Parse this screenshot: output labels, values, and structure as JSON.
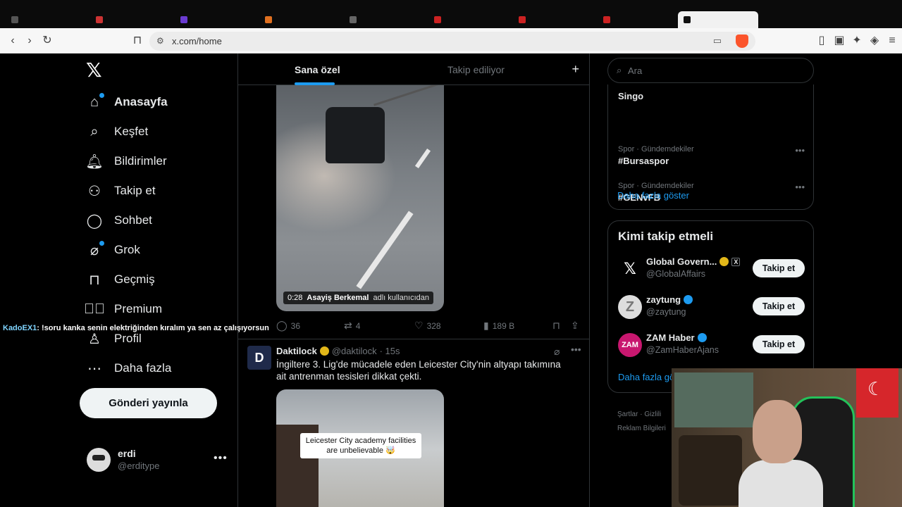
{
  "browser": {
    "url": "x.com/home",
    "shield_badge": "1"
  },
  "nav": {
    "items": [
      {
        "label": "Anasayfa",
        "icon": "home-icon"
      },
      {
        "label": "Keşfet",
        "icon": "search-icon"
      },
      {
        "label": "Bildirimler",
        "icon": "bell-icon"
      },
      {
        "label": "Takip et",
        "icon": "follow-icon"
      },
      {
        "label": "Sohbet",
        "icon": "chat-icon"
      },
      {
        "label": "Grok",
        "icon": "grok-icon"
      },
      {
        "label": "Geçmiş",
        "icon": "bookmark-icon"
      },
      {
        "label": "Premium",
        "icon": "premium-icon"
      },
      {
        "label": "Profil",
        "icon": "profile-icon"
      },
      {
        "label": "Daha fazla",
        "icon": "more-icon"
      }
    ],
    "post_button": "Gönderi yayınla",
    "profile": {
      "name": "erdi",
      "handle": "@erditype"
    }
  },
  "stream_chat": {
    "user": "KadoEX1",
    "message": ": !soru kanka senin elektriğinden kıralım ya sen az çalışıyorsun"
  },
  "feed": {
    "tabs": [
      {
        "label": "Sana özel",
        "active": true
      },
      {
        "label": "Takip ediliyor",
        "active": false
      }
    ],
    "tweet1": {
      "video_duration": "0:28",
      "video_user": "Asayiş Berkemal",
      "video_user_suffix": "adlı kullanıcıdan",
      "replies": "36",
      "retweets": "4",
      "likes": "328",
      "views": "189 B"
    },
    "tweet2": {
      "name": "Daktilock",
      "handle": "@daktilock",
      "time": "· 15s",
      "text": "İngiltere 3. Lig'de mücadele eden Leicester City'nin altyapı takımına ait antrenman tesisleri dikkat çekti.",
      "media_caption": "Leicester City academy facilities are unbelievable 🤯"
    }
  },
  "sidebar": {
    "search_placeholder": "Ara",
    "trends": [
      {
        "meta": "",
        "name": "Singo"
      },
      {
        "meta": "Spor · Gündemdekiler",
        "name": "#Bursaspor"
      },
      {
        "meta": "Spor · Gündemdekiler",
        "name": "#GENvFB"
      }
    ],
    "show_more": "Daha fazla göster",
    "who_to_follow_title": "Kimi takip etmeli",
    "who_to_follow": [
      {
        "name": "Global Govern...",
        "handle": "@GlobalAffairs",
        "button": "Takip et"
      },
      {
        "name": "zaytung",
        "handle": "@zaytung",
        "button": "Takip et"
      },
      {
        "name": "ZAM Haber",
        "handle": "@ZamHaberAjans",
        "button": "Takip et"
      }
    ],
    "who_show_more": "Daha fazla gö",
    "footer": [
      "Şartlar",
      "Gizlili",
      "Reklam Bilgileri"
    ]
  },
  "colors": {
    "accent": "#1d9bf0",
    "background": "#000000",
    "gold_badge": "#e2b719"
  }
}
